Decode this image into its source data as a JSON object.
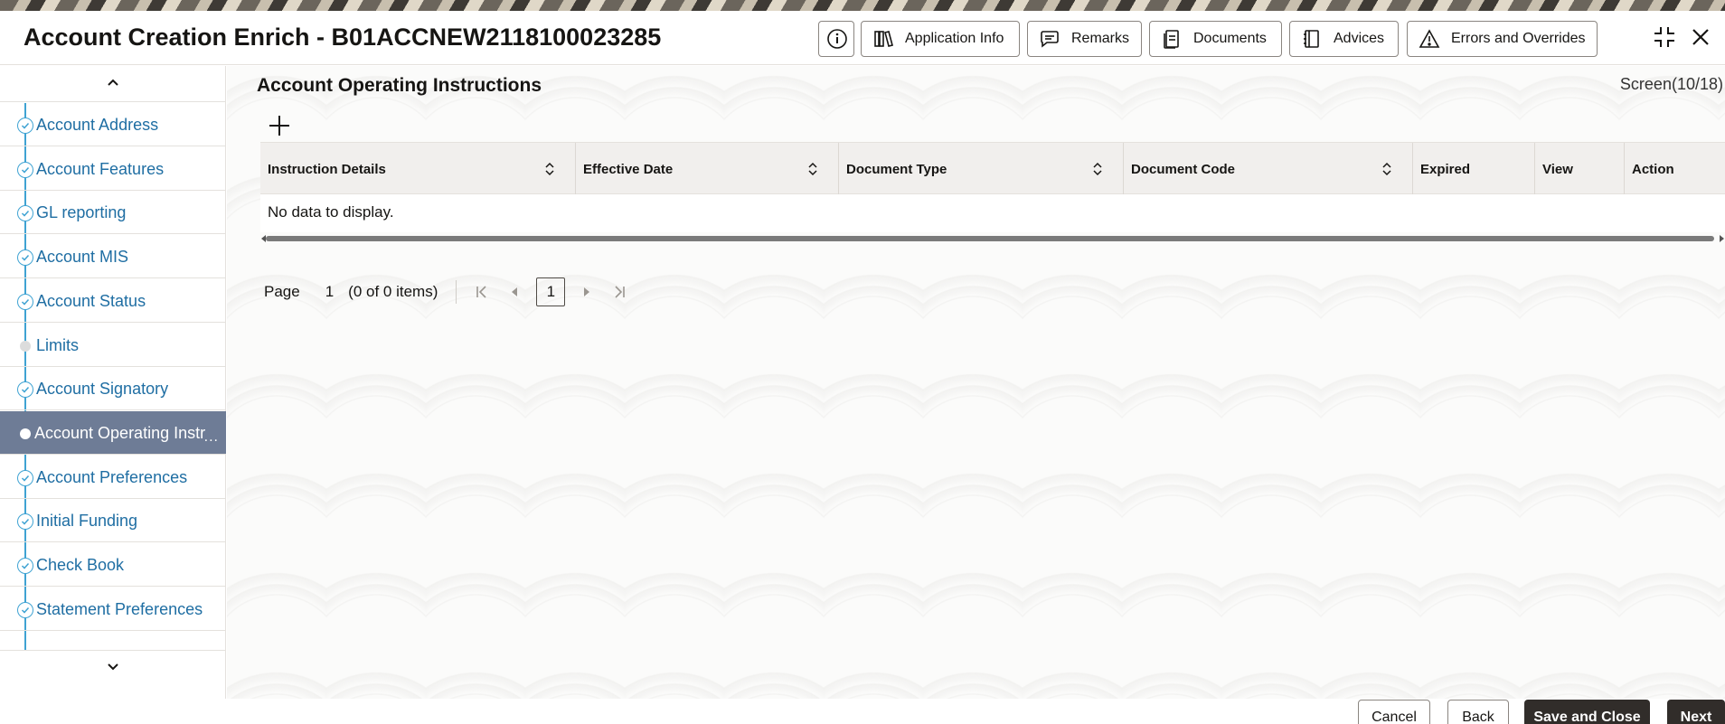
{
  "window": {
    "title": "Account Creation Enrich - B01ACCNEW2118100023285"
  },
  "header_buttons": {
    "info_icon": "info-circle-icon",
    "application_info": "Application Info",
    "remarks": "Remarks",
    "documents": "Documents",
    "advices": "Advices",
    "errors_overrides": "Errors and Overrides"
  },
  "sidebar": {
    "items": [
      {
        "label": "Account Address",
        "state": "done"
      },
      {
        "label": "Account Features",
        "state": "done"
      },
      {
        "label": "GL reporting",
        "state": "done"
      },
      {
        "label": "Account MIS",
        "state": "done"
      },
      {
        "label": "Account Status",
        "state": "done"
      },
      {
        "label": "Limits",
        "state": "pending"
      },
      {
        "label": "Account Signatory",
        "state": "done"
      },
      {
        "label": "Account Operating Instr",
        "state": "active"
      },
      {
        "label": "Account Preferences",
        "state": "done"
      },
      {
        "label": "Initial Funding",
        "state": "done"
      },
      {
        "label": "Check Book",
        "state": "done"
      },
      {
        "label": "Statement Preferences",
        "state": "done"
      }
    ],
    "active_ellipsis": "..."
  },
  "main": {
    "section_title": "Account Operating Instructions",
    "screen_counter": "Screen(10/18)",
    "table": {
      "columns": [
        "Instruction Details",
        "Effective Date",
        "Document Type",
        "Document Code",
        "Expired",
        "View",
        "Action"
      ],
      "empty_text": "No data to display."
    },
    "pager": {
      "page_label": "Page",
      "page_value": "1",
      "items_text": "(0 of 0 items)",
      "current_page": "1"
    }
  },
  "footer": {
    "cancel": "Cancel",
    "back": "Back",
    "save_close": "Save and Close",
    "next": "Next"
  },
  "colors": {
    "accent": "#3fa3d3",
    "active_row": "#6e7c96",
    "primary_button": "#312d2a",
    "link_text": "#1f6ea3"
  }
}
